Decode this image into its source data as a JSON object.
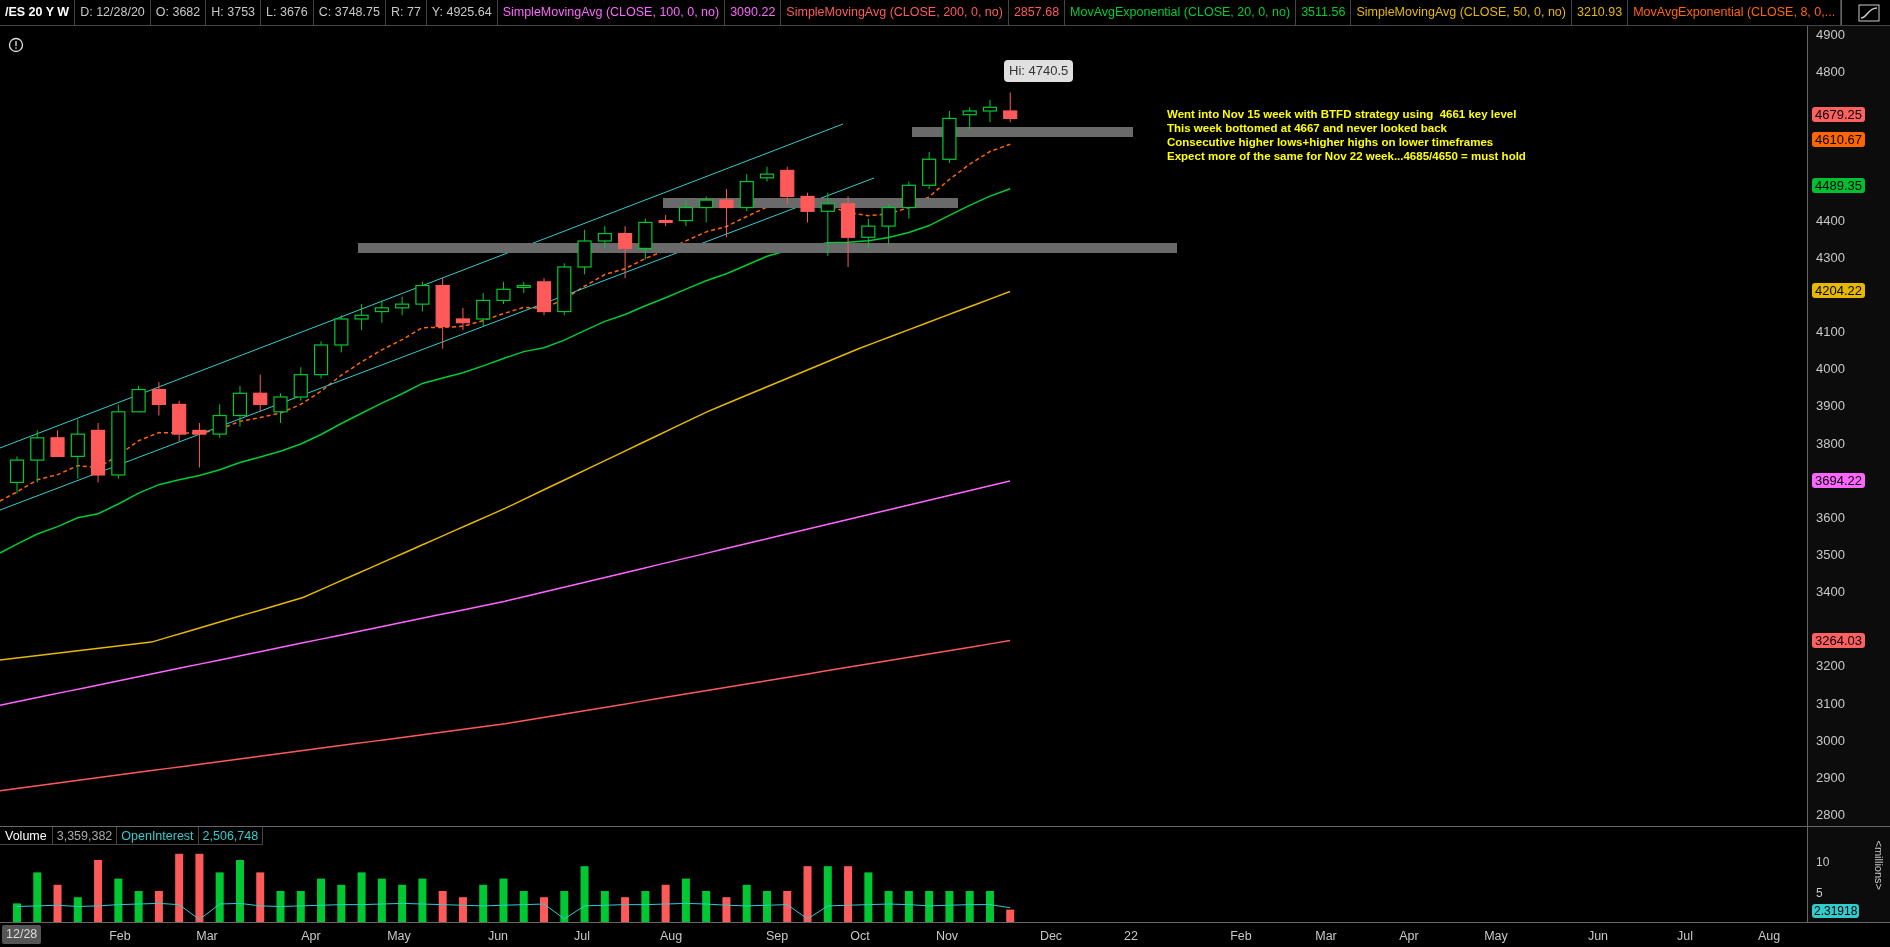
{
  "header": {
    "symbol": "/ES 20 Y W",
    "fields": [
      "D: 12/28/20",
      "O: 3682",
      "H: 3753",
      "L: 3676",
      "C: 3748.75",
      "R: 77",
      "Y: 4925.64"
    ],
    "studies": [
      {
        "name": "SimpleMovingAvg (CLOSE, 100, 0, no)",
        "value": "3090.22",
        "color": "#ff66ff"
      },
      {
        "name": "SimpleMovingAvg (CLOSE, 200, 0, no)",
        "value": "2857.68",
        "color": "#ff5a5a"
      },
      {
        "name": "MovAvgExponential (CLOSE, 20, 0, no)",
        "value": "3511.56",
        "color": "#00cc33"
      },
      {
        "name": "SimpleMovingAvg (CLOSE, 50, 0, no)",
        "value": "3210.93",
        "color": "#e6b800"
      },
      {
        "name": "MovAvgExponential (CLOSE, 8, 0,...",
        "color": "#ff6600"
      }
    ]
  },
  "chart": {
    "high_label": "Hi: 4740.5",
    "notes": [
      "Went into Nov 15 week with BTFD strategy using  4661 key level",
      "This week bottomed at 4667 and never looked back",
      "Consecutive higher lows+higher highs on lower timeframes",
      "Expect more of the same for Nov 22 week...4685/4650 = must hold"
    ]
  },
  "price_axis": {
    "labels": [
      "4900",
      "4800",
      "4400",
      "4300",
      "4100",
      "4000",
      "3900",
      "3800",
      "3600",
      "3500",
      "3400",
      "3200",
      "3100",
      "3000",
      "2900",
      "2800"
    ],
    "badges": [
      {
        "text": "4679.25",
        "color": "#ff6060"
      },
      {
        "text": "4610.67",
        "color": "#ff6600"
      },
      {
        "text": "4489.35",
        "color": "#00c030"
      },
      {
        "text": "4204.22",
        "color": "#e6b800"
      },
      {
        "text": "3694.22",
        "color": "#ff66ff"
      },
      {
        "text": "3264.03",
        "color": "#ff6060"
      }
    ]
  },
  "volume": {
    "label": "Volume",
    "value": "3,359,382",
    "oi_label": "OpenInterest",
    "oi_value": "2,506,748",
    "axis": [
      "10",
      "5"
    ],
    "badge": "2.31918",
    "unit": "<millions>"
  },
  "time_axis": {
    "cursor": "12/28",
    "labels": [
      "Feb",
      "Mar",
      "Apr",
      "May",
      "Jun",
      "Jul",
      "Aug",
      "Sep",
      "Oct",
      "Nov",
      "Dec",
      "22",
      "Feb",
      "Mar",
      "Apr",
      "May",
      "Jun",
      "Jul",
      "Aug"
    ]
  }
}
